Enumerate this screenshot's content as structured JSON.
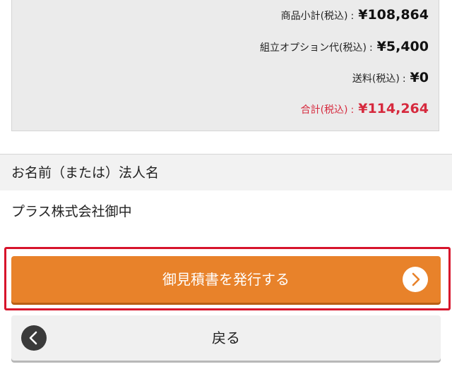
{
  "summary": {
    "subtotal_label": "商品小計(税込)",
    "subtotal_value": "¥108,864",
    "assembly_label": "組立オプション代(税込)",
    "assembly_value": "¥5,400",
    "shipping_label": "送料(税込)",
    "shipping_value": "¥0",
    "total_label": "合計(税込)",
    "total_value": "¥114,264",
    "separator": ":"
  },
  "customer": {
    "header_label": "お名前（または）法人名",
    "name_value": "プラス株式会社御中"
  },
  "actions": {
    "issue_quote_label": "御見積書を発行する",
    "back_label": "戻る"
  },
  "icons": {
    "issue_arrow": "chevron-right-icon",
    "back_arrow": "chevron-left-icon"
  },
  "colors": {
    "accent": "#e8822a",
    "total_red": "#d6293d",
    "highlight_red": "#d7142b"
  }
}
